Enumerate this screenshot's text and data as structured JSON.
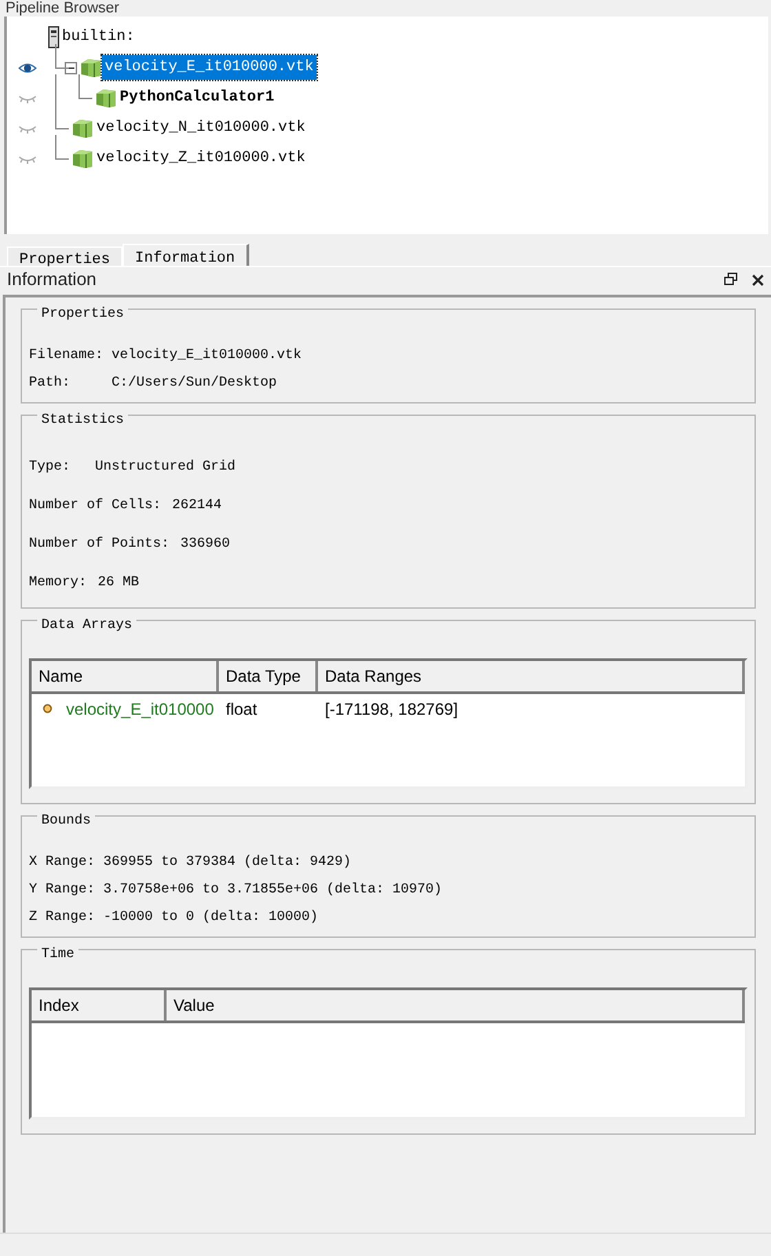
{
  "pipeline_browser": {
    "title": "Pipeline Browser",
    "items": [
      {
        "label": "builtin:",
        "kind": "server",
        "children": [
          {
            "label": "velocity_E_it010000.vtk",
            "kind": "source",
            "visible": true,
            "selected": true,
            "expanded": true,
            "pending": false,
            "children": [
              {
                "label": "PythonCalculator1",
                "kind": "source",
                "visible": false,
                "selected": false,
                "pending": true
              }
            ]
          },
          {
            "label": "velocity_N_it010000.vtk",
            "kind": "source",
            "visible": false,
            "selected": false,
            "pending": false
          },
          {
            "label": "velocity_Z_it010000.vtk",
            "kind": "source",
            "visible": false,
            "selected": false,
            "pending": false
          }
        ]
      }
    ]
  },
  "tabs": [
    {
      "label": "Properties",
      "selected": false
    },
    {
      "label": "Information",
      "selected": true
    }
  ],
  "information_panel": {
    "title": "Information",
    "properties": {
      "title": "Properties",
      "fields": [
        {
          "label": "Filename:",
          "value": "velocity_E_it010000.vtk"
        },
        {
          "label": "Path:",
          "value": "C:/Users/Sun/Desktop"
        }
      ]
    },
    "statistics": {
      "title": "Statistics",
      "fields": [
        {
          "label": "Type:",
          "value": "Unstructured Grid"
        },
        {
          "label": "Number of Cells:",
          "value": "262144"
        },
        {
          "label": "Number of Points:",
          "value": "336960"
        },
        {
          "label": "Memory:",
          "value": "26 MB"
        }
      ]
    },
    "data_arrays": {
      "title": "Data Arrays",
      "columns": [
        "Name",
        "Data Type",
        "Data Ranges"
      ],
      "rows": [
        {
          "kind": "point",
          "name": "velocity_E_it010000",
          "type": "float",
          "range": "[-171198, 182769]"
        }
      ]
    },
    "bounds": {
      "title": "Bounds",
      "lines": [
        "X Range: 369955 to 379384 (delta: 9429)",
        "Y Range: 3.70758e+06 to 3.71855e+06 (delta: 10970)",
        "Z Range: -10000 to 0 (delta: 10000)"
      ]
    },
    "time": {
      "title": "Time",
      "columns": [
        "Index",
        "Value"
      ]
    }
  }
}
